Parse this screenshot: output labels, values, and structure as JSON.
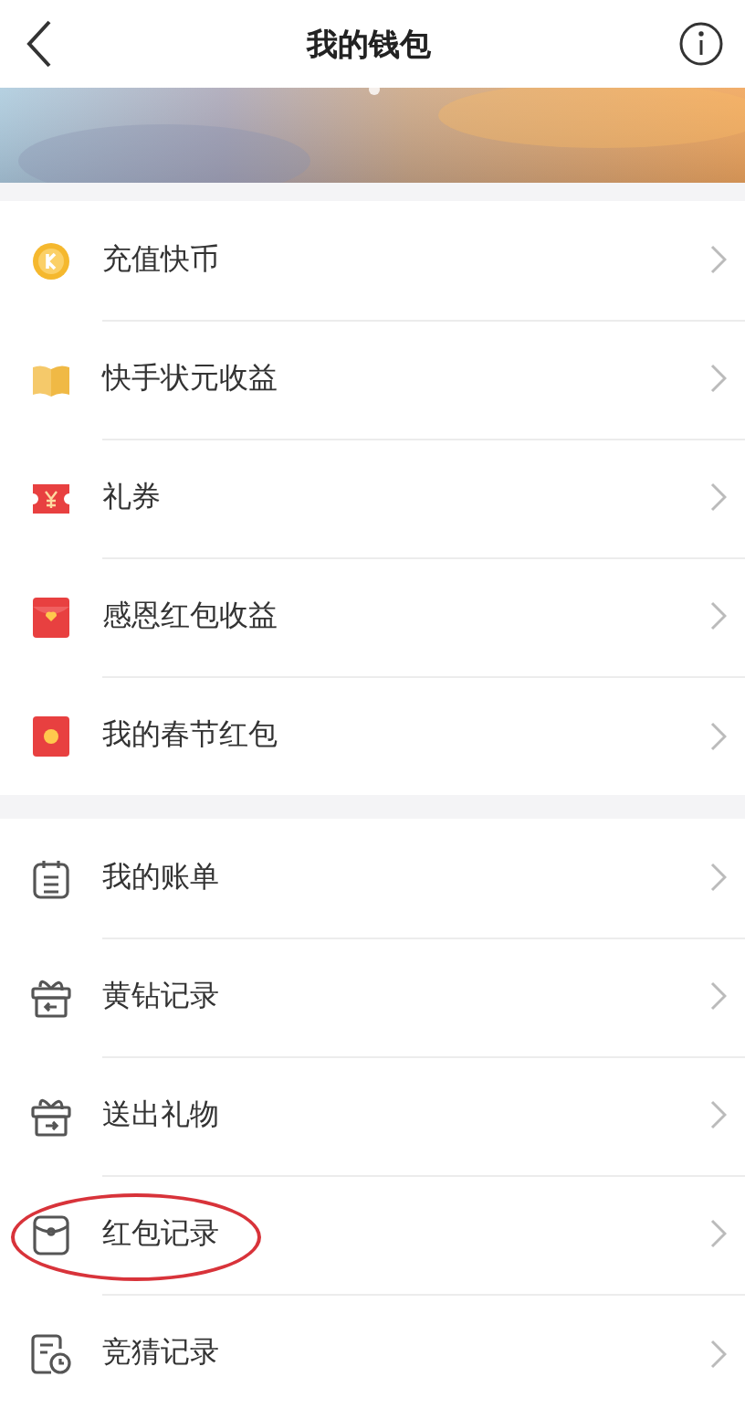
{
  "header": {
    "title": "我的钱包"
  },
  "groups": [
    {
      "items": [
        {
          "label": "充值快币",
          "highlighted": false
        },
        {
          "label": "快手状元收益",
          "highlighted": false
        },
        {
          "label": "礼券",
          "highlighted": false
        },
        {
          "label": "感恩红包收益",
          "highlighted": false
        },
        {
          "label": "我的春节红包",
          "highlighted": false
        }
      ]
    },
    {
      "items": [
        {
          "label": "我的账单",
          "highlighted": false
        },
        {
          "label": "黄钻记录",
          "highlighted": false
        },
        {
          "label": "送出礼物",
          "highlighted": false
        },
        {
          "label": "红包记录",
          "highlighted": true
        },
        {
          "label": "竞猜记录",
          "highlighted": false
        }
      ]
    }
  ]
}
